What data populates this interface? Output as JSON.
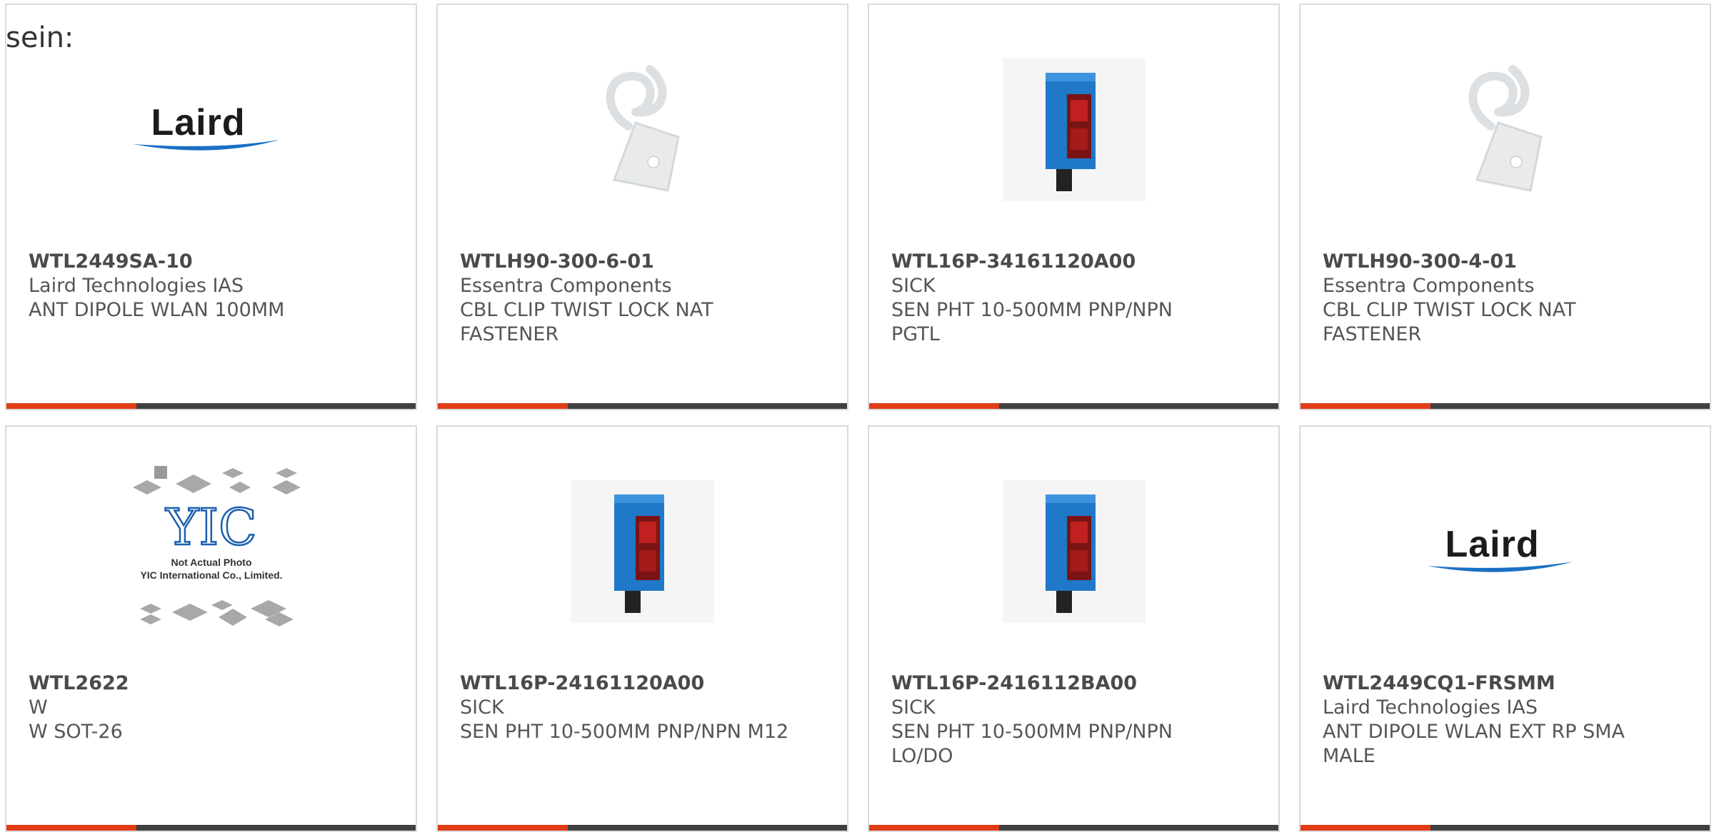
{
  "intro_text": "sein:",
  "colors": {
    "accent": "#e03c17",
    "bar": "#404040",
    "card_border": "#dadada"
  },
  "products": [
    {
      "part_number": "WTL2449SA-10",
      "manufacturer": "Laird Technologies IAS",
      "description": "ANT DIPOLE WLAN 100MM",
      "image": "laird-logo"
    },
    {
      "part_number": "WTLH90-300-6-01",
      "manufacturer": "Essentra Components",
      "description": "CBL CLIP TWIST LOCK NAT FASTENER",
      "image": "cable-clip"
    },
    {
      "part_number": "WTL16P-34161120A00",
      "manufacturer": "SICK",
      "description": "SEN PHT 10-500MM PNP/NPN PGTL",
      "image": "photo-sensor"
    },
    {
      "part_number": "WTLH90-300-4-01",
      "manufacturer": "Essentra Components",
      "description": "CBL CLIP TWIST LOCK NAT FASTENER",
      "image": "cable-clip"
    },
    {
      "part_number": "WTL2622",
      "manufacturer": "W",
      "description": "W SOT-26",
      "image": "yic-placeholder",
      "image_text": [
        "Not Actual Photo",
        "YIC International Co., Limited."
      ]
    },
    {
      "part_number": "WTL16P-24161120A00",
      "manufacturer": "SICK",
      "description": "SEN PHT 10-500MM PNP/NPN M12",
      "image": "photo-sensor"
    },
    {
      "part_number": "WTL16P-2416112BA00",
      "manufacturer": "SICK",
      "description": "SEN PHT 10-500MM PNP/NPN LO/DO",
      "image": "photo-sensor"
    },
    {
      "part_number": "WTL2449CQ1-FRSMM",
      "manufacturer": "Laird Technologies IAS",
      "description": "ANT DIPOLE WLAN EXT RP SMA MALE",
      "image": "laird-logo"
    }
  ]
}
